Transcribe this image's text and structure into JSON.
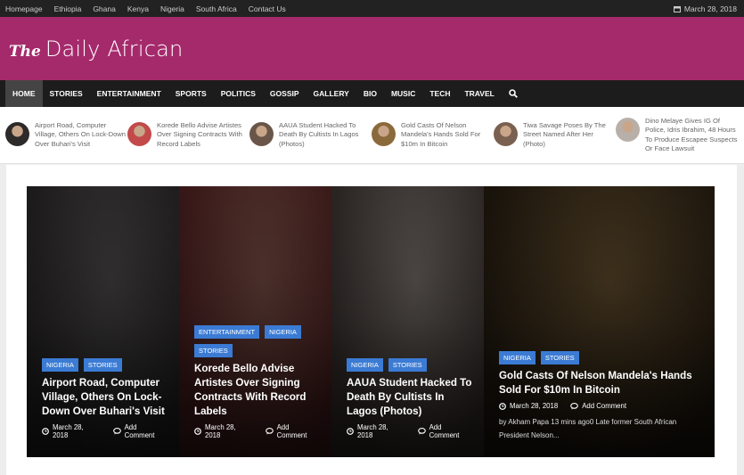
{
  "topbar": {
    "links": [
      "Homepage",
      "Ethiopia",
      "Ghana",
      "Kenya",
      "Nigeria",
      "South Africa",
      "Contact Us"
    ],
    "date": "March 28, 2018"
  },
  "header": {
    "logo_the": "The",
    "logo_name": "Daily African"
  },
  "nav": {
    "items": [
      "HOME",
      "STORIES",
      "ENTERTAINMENT",
      "SPORTS",
      "POLITICS",
      "GOSSIP",
      "GALLERY",
      "BIO",
      "MUSIC",
      "TECH",
      "TRAVEL"
    ],
    "active": "HOME"
  },
  "ticker": [
    {
      "text": "Airport Road, Computer Village, Others On Lock-Down Over Buhari's Visit",
      "thumb_color": "#2e2a2a"
    },
    {
      "text": "Korede Bello Advise Artistes Over Signing Contracts With Record Labels",
      "thumb_color": "#c24a4a"
    },
    {
      "text": "AAUA Student Hacked To Death By Cultists In Lagos (Photos)",
      "thumb_color": "#6a5648"
    },
    {
      "text": "Gold Casts Of Nelson Mandela's Hands Sold For $10m In Bitcoin",
      "thumb_color": "#8a6a3a"
    },
    {
      "text": "Tiwa Savage Poses By The Street Named After Her (Photo)",
      "thumb_color": "#7a6050"
    },
    {
      "text": "Dino Melaye Gives IG Of Police, Idris Ibrahim, 48 Hours To Produce Escapee Suspects Or Face Lawsuit",
      "thumb_color": "#b8b0a8"
    }
  ],
  "slides": [
    {
      "tags": [
        "NIGERIA",
        "STORIES"
      ],
      "title": "Airport Road, Computer Village, Others On Lock-Down Over Buhari's Visit",
      "date": "March 28, 2018",
      "comment": "Add Comment",
      "colors": [
        "#3a3838",
        "#1e1c1c"
      ]
    },
    {
      "tags": [
        "ENTERTAINMENT",
        "NIGERIA",
        "STORIES"
      ],
      "title": "Korede Bello Advise Artistes Over Signing Contracts With Record Labels",
      "date": "March 28, 2018",
      "comment": "Add Comment",
      "colors": [
        "#5a3a34",
        "#3a1818"
      ]
    },
    {
      "tags": [
        "NIGERIA",
        "STORIES"
      ],
      "title": "AAUA Student Hacked To Death By Cultists In Lagos (Photos)",
      "date": "March 28, 2018",
      "comment": "Add Comment",
      "colors": [
        "#5a5450",
        "#2c2624"
      ]
    },
    {
      "tags": [
        "NIGERIA",
        "STORIES"
      ],
      "title": "Gold Casts Of Nelson Mandela's Hands Sold For $10m In Bitcoin",
      "date": "March 28, 2018",
      "comment": "Add Comment",
      "excerpt": "by Akham Papa 13 mins ago0 Late former South African President Nelson...",
      "colors": [
        "#4a3a22",
        "#1a140c"
      ]
    }
  ],
  "colors": {
    "brand": "#a52a6c",
    "tag": "#3b7bd4",
    "nav": "#1c1c1c",
    "topbar": "#222222"
  }
}
